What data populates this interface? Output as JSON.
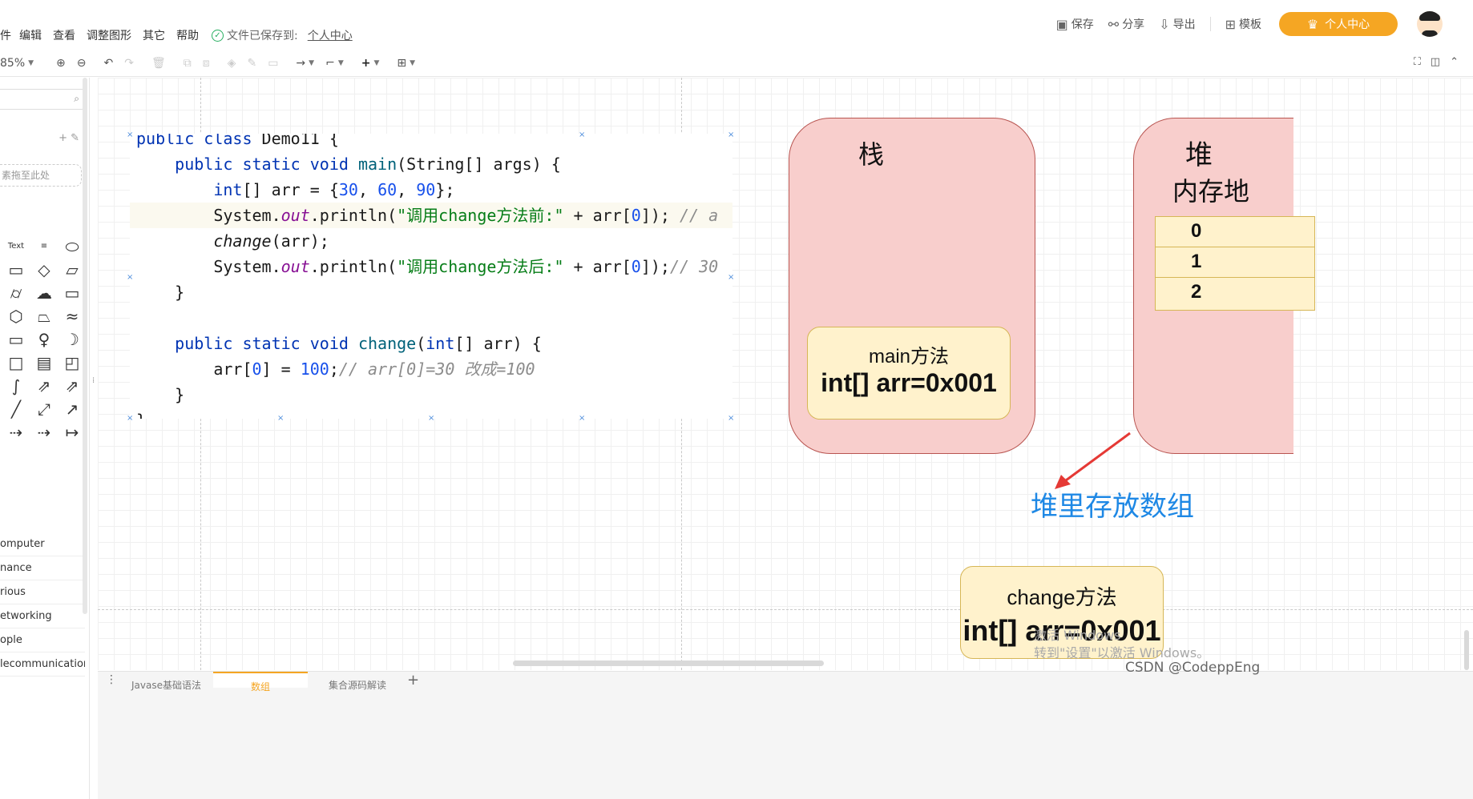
{
  "menu": {
    "items": [
      "件",
      "编辑",
      "查看",
      "调整图形",
      "其它",
      "帮助"
    ],
    "saved_text": "文件已保存到:",
    "saved_location": "个人中心"
  },
  "actions": {
    "save": "保存",
    "share": "分享",
    "export": "导出",
    "template": "模板",
    "vip": "个人中心"
  },
  "toolbar": {
    "zoom": "85%"
  },
  "sidebar": {
    "drop_hint": "素拖至此处",
    "text_shape_label": "Text",
    "categories": [
      "omputer",
      "nance",
      "rious",
      "etworking",
      "ople",
      "lecommunication"
    ]
  },
  "code": {
    "lines": [
      [
        [
          "kw",
          "public "
        ],
        [
          "kw",
          "class "
        ],
        [
          "n",
          "Demo11 {"
        ]
      ],
      [
        [
          "n",
          "    "
        ],
        [
          "kw",
          "public static void "
        ],
        [
          "fn",
          "main"
        ],
        [
          "n",
          "(String[] args) {"
        ]
      ],
      [
        [
          "n",
          "        "
        ],
        [
          "kw",
          "int"
        ],
        [
          "n",
          "[] arr = {"
        ],
        [
          "num",
          "30"
        ],
        [
          "n",
          ", "
        ],
        [
          "num",
          "60"
        ],
        [
          "n",
          ", "
        ],
        [
          "num",
          "90"
        ],
        [
          "n",
          "};"
        ]
      ],
      [
        [
          "n",
          "        System."
        ],
        [
          "fld",
          "out"
        ],
        [
          "n",
          ".println("
        ],
        [
          "str",
          "\"调用change方法前:\""
        ],
        [
          "n",
          " + arr["
        ],
        [
          "num",
          "0"
        ],
        [
          "n",
          "]); "
        ],
        [
          "cm",
          "// a"
        ]
      ],
      [
        [
          "n",
          "        "
        ],
        [
          "it",
          "change"
        ],
        [
          "n",
          "(arr);"
        ]
      ],
      [
        [
          "n",
          "        System."
        ],
        [
          "fld",
          "out"
        ],
        [
          "n",
          ".println("
        ],
        [
          "str",
          "\"调用change方法后:\""
        ],
        [
          "n",
          " + arr["
        ],
        [
          "num",
          "0"
        ],
        [
          "n",
          "]);"
        ],
        [
          "cm",
          "// 30"
        ]
      ],
      [
        [
          "n",
          "    }"
        ]
      ],
      [
        [
          "n",
          ""
        ]
      ],
      [
        [
          "n",
          "    "
        ],
        [
          "kw",
          "public static void "
        ],
        [
          "fn",
          "change"
        ],
        [
          "n",
          "("
        ],
        [
          "kw",
          "int"
        ],
        [
          "n",
          "[] arr) {"
        ]
      ],
      [
        [
          "n",
          "        arr["
        ],
        [
          "num",
          "0"
        ],
        [
          "n",
          "] = "
        ],
        [
          "num",
          "100"
        ],
        [
          "n",
          ";"
        ],
        [
          "cm",
          "// arr[0]=30 改成=100"
        ]
      ],
      [
        [
          "n",
          "    }"
        ]
      ],
      [
        [
          "n",
          "}"
        ]
      ]
    ]
  },
  "diagram": {
    "stack_title": "栈",
    "heap_title": "堆",
    "heap_subtitle": "内存地",
    "heap_cells": [
      "0",
      "1",
      "2"
    ],
    "main_box_title": "main方法",
    "main_box_value": "int[] arr=0x001",
    "heap_note": "堆里存放数组",
    "change_box_title": "change方法",
    "change_box_value": "int[] arr=0x001",
    "arrow_color": "#e53935",
    "stack_fill": "#f8cecc",
    "box_fill": "#fff2cc",
    "note_color": "#1e88e5"
  },
  "watermark": {
    "line1": "激活 Windows",
    "line2": "转到\"设置\"以激活 Windows。"
  },
  "tabs": {
    "items": [
      "Javase基础语法",
      "数组",
      "集合源码解读"
    ],
    "active_index": 1
  },
  "credit": "CSDN @CodeppEng"
}
